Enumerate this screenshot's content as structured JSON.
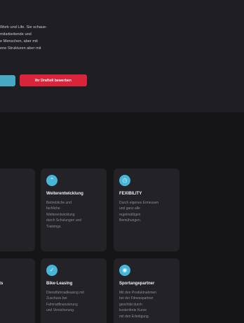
{
  "hero": {
    "lines": [
      "Work und Life. Sie schaue-",
      "mitarbeitende und",
      "e Menschen, aber mit",
      "ene Strukturen aber mit"
    ],
    "primary_button_label": "Ihr Draftoll bewerben",
    "secondary_button_label": ""
  },
  "cards": [
    {
      "title": "",
      "icon": "partial-icon",
      "desc": [
        "",
        "",
        "",
        ""
      ]
    },
    {
      "title": "Weiterentwicklung",
      "icon": "growth-icon",
      "desc": [
        "Betriebliche und",
        "fachliche",
        "Weiterentwicklung",
        "durch Schulungen und",
        "Trainings."
      ]
    },
    {
      "title": "FEXIBILITY",
      "icon": "clock-icon",
      "desc": [
        "Durch eigenes Ermessen",
        "und ganz alle",
        "regelmäßigen",
        "Bemühungen."
      ]
    },
    {
      "title": "ents",
      "icon": "partial-icon",
      "desc": [
        "",
        "",
        "",
        ""
      ]
    },
    {
      "title": "Bike-Leasing",
      "icon": "bike-icon",
      "desc": [
        "Dienstfahrradleasing mit",
        "Zuschuss bei",
        "Fahrradfinanzierung",
        "und Versicherung."
      ]
    },
    {
      "title": "Sportangepartner",
      "icon": "sport-icon",
      "desc": [
        "Mit den Produktnahmen",
        "bei der Fitnesspartner",
        "geschtät durch",
        "kostenfreie Kurse",
        "mit den Erledigung."
      ]
    }
  ]
}
